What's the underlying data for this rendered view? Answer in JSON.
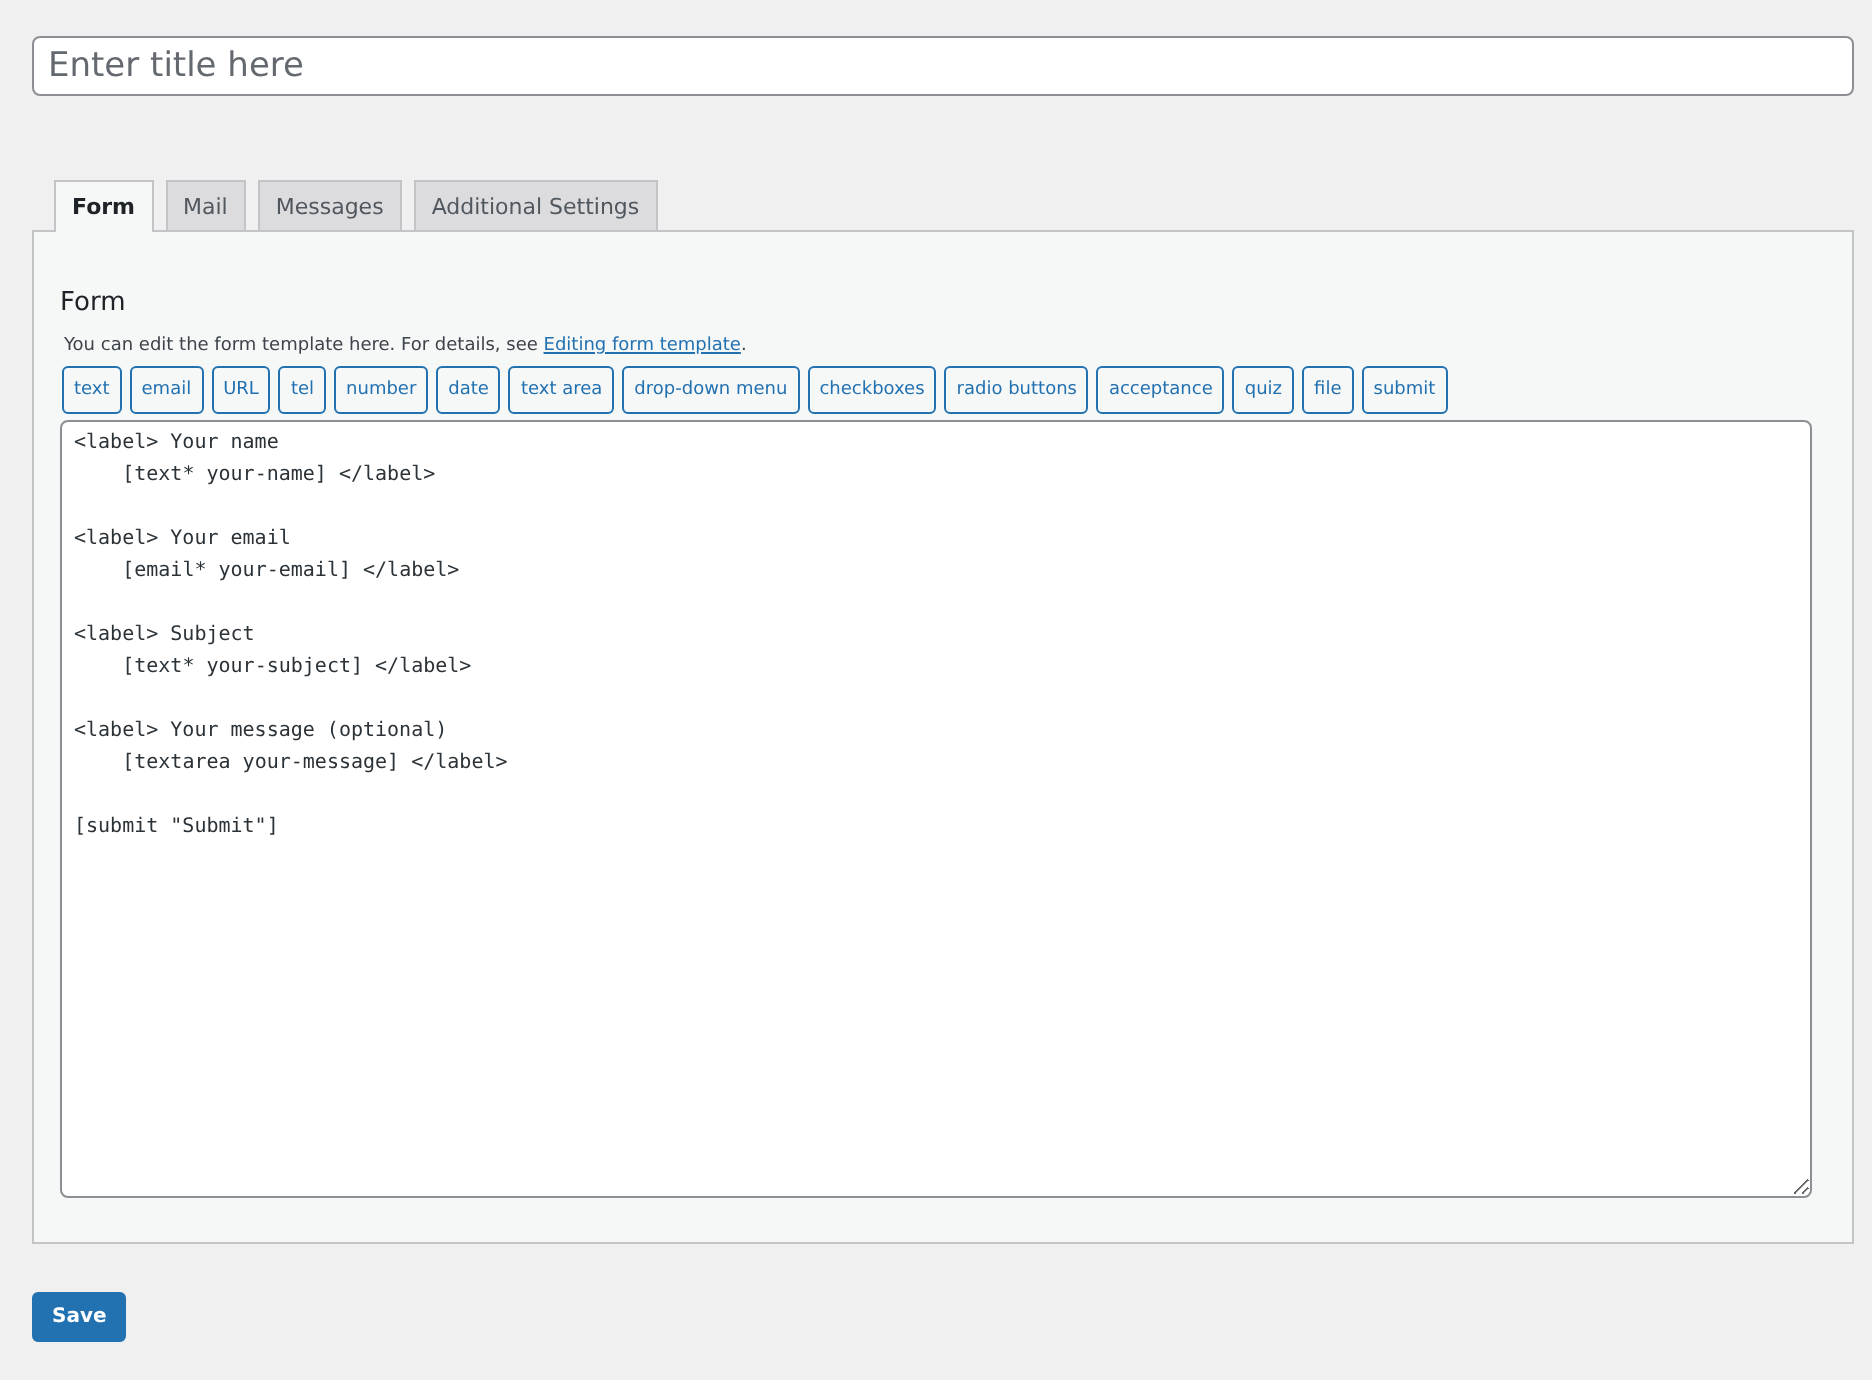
{
  "title_field": {
    "placeholder": "Enter title here"
  },
  "tabs": [
    {
      "label": "Form",
      "selected": true
    },
    {
      "label": "Mail",
      "selected": false
    },
    {
      "label": "Messages",
      "selected": false
    },
    {
      "label": "Additional Settings",
      "selected": false
    }
  ],
  "panel": {
    "heading": "Form",
    "description": "You can edit the form template here. For details, see ",
    "link": "Editing form template",
    "after_link": ".",
    "tag_buttons": [
      "text",
      "email",
      "URL",
      "tel",
      "number",
      "date",
      "text area",
      "drop-down menu",
      "checkboxes",
      "radio buttons",
      "acceptance",
      "quiz",
      "file",
      "submit"
    ],
    "template": "<label> Your name\n    [text* your-name] </label>\n\n<label> Your email\n    [email* your-email] </label>\n\n<label> Subject\n    [text* your-subject] </label>\n\n<label> Your message (optional)\n    [textarea your-message] </label>\n\n[submit \"Submit\"]"
  },
  "save_button": "Save"
}
